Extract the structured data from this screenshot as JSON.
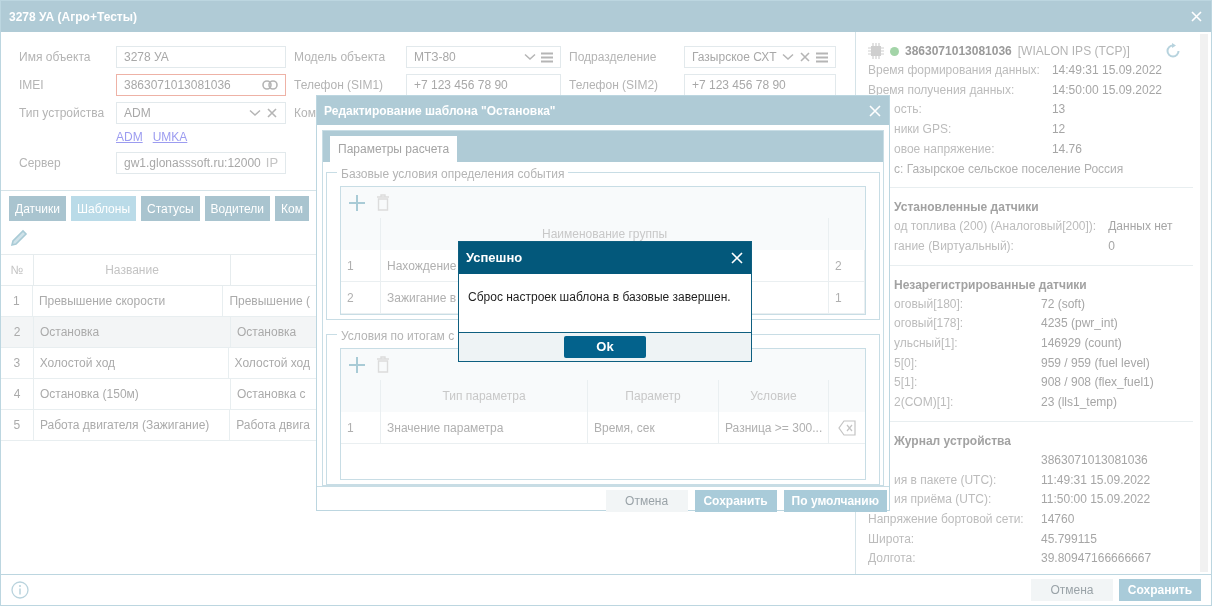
{
  "window": {
    "title": "3278 УА (Агро+Тесты)"
  },
  "form": {
    "rows": [
      {
        "cells": [
          {
            "label": "Имя объекта",
            "value": "3278 УА",
            "kind": "text",
            "invalid": false
          },
          {
            "label": "Модель объекта",
            "value": "МТЗ-80",
            "kind": "select_list",
            "invalid": false
          },
          {
            "label": "Подразделение",
            "value": "Газырское СХТ",
            "kind": "select_clear_list",
            "invalid": false
          }
        ]
      },
      {
        "cells": [
          {
            "label": "IMEI",
            "value": "3863071013081036",
            "kind": "link",
            "invalid": true
          },
          {
            "label": "Телефон (SIM1)",
            "value": "+7 123 456 78 90",
            "kind": "text",
            "invalid": false
          },
          {
            "label": "Телефон (SIM2)",
            "value": "+7 123 456 78 90",
            "kind": "text",
            "invalid": false
          }
        ]
      },
      {
        "cells": [
          {
            "label": "Тип устройства",
            "value": "ADM",
            "kind": "select_clear",
            "invalid": false
          },
          {
            "label": "Ком",
            "kind": "label_only"
          }
        ]
      },
      {
        "links": [
          "ADM",
          "UMKA"
        ]
      },
      {
        "cells": [
          {
            "label": "Сервер",
            "value": "gw1.glonasssoft.ru:12000",
            "kind": "suffix",
            "suffix": "IP",
            "invalid": false
          }
        ]
      }
    ]
  },
  "tabs": [
    {
      "label": "Датчики",
      "selected": false
    },
    {
      "label": "Шаблоны",
      "selected": true
    },
    {
      "label": "Статусы",
      "selected": false
    },
    {
      "label": "Водители",
      "selected": false
    },
    {
      "label": "Ком",
      "selected": false
    }
  ],
  "templates_table": {
    "columns": [
      "№",
      "Название"
    ],
    "rows": [
      {
        "cells": [
          "1",
          "Превышение скорости",
          "Превышение ("
        ],
        "selected": false
      },
      {
        "cells": [
          "2",
          "Остановка",
          "Остановка"
        ],
        "selected": true
      },
      {
        "cells": [
          "3",
          "Холостой ход",
          "Холостой ход"
        ],
        "selected": false
      },
      {
        "cells": [
          "4",
          "Остановка (150м)",
          "Остановка с"
        ],
        "selected": false
      },
      {
        "cells": [
          "5",
          "Работа двигателя (Зажигание)",
          "Работа двига"
        ],
        "selected": false
      }
    ]
  },
  "edit_dialog": {
    "title": "Редактирование шаблона \"Остановка\"",
    "tabs": [
      {
        "label": "Параметры расчета",
        "selected": true
      }
    ],
    "base_conditions": {
      "legend": "Базовые условия определения события",
      "columns": [
        "",
        "Наименование группы"
      ],
      "rows": [
        {
          "cells": [
            "1",
            "Нахождение",
            "2"
          ]
        },
        {
          "cells": [
            "2",
            "Зажигание в",
            "1"
          ]
        }
      ]
    },
    "result_conditions": {
      "legend": "Условия по итогам с",
      "columns": [
        "",
        "Тип параметра",
        "Параметр",
        "Условие"
      ],
      "rows": [
        {
          "cells": [
            "1",
            "Значение параметра",
            "Время, сек",
            "Разница >= 300..."
          ]
        }
      ]
    },
    "buttons": [
      {
        "label": "Отмена",
        "disabled": true
      },
      {
        "label": "Сохранить",
        "disabled": false
      },
      {
        "label": "По умолчанию",
        "disabled": false
      }
    ]
  },
  "success_dialog": {
    "title": "Успешно",
    "message": "Сброс настроек шаблона в базовые завершен.",
    "button": "Ok"
  },
  "device_panel": {
    "id": "3863071013081036",
    "protocol": "[WIALON IPS (TCP)]",
    "online": true,
    "sections": [
      {
        "rows": [
          {
            "label": "Время формирования данных:",
            "value": "14:49:31 15.09.2022"
          },
          {
            "label": "Время получения данных:",
            "value": "14:50:00 15.09.2022"
          },
          {
            "label": "ость:",
            "value": "13"
          },
          {
            "label": "ники GPS:",
            "value": "12"
          },
          {
            "label": "овое напряжение:",
            "value": "14.76"
          },
          {
            "text": "с: Газырское сельское поселение Россия"
          }
        ]
      },
      {
        "title": "Установленные датчики",
        "rows": [
          {
            "label": "од топлива (200) (Аналоговый[200]):",
            "value": "Данных нет"
          },
          {
            "label": "гание (Виртуальный):",
            "value": "0"
          }
        ]
      },
      {
        "title": "Незарегистрированные датчики",
        "rows": [
          {
            "label": "оговый[180]:",
            "value": "72 (soft)"
          },
          {
            "label": "оговый[178]:",
            "value": "4235 (pwr_int)"
          },
          {
            "label": "ульсный[1]:",
            "value": "146929 (count)"
          },
          {
            "label": "5[0]:",
            "value": "959 / 959 (fuel level)"
          },
          {
            "label": "5[1]:",
            "value": "908 / 908 (flex_fuel1)"
          },
          {
            "label": "2(COM)[1]:",
            "value": "23 (lls1_temp)"
          }
        ]
      },
      {
        "title": "Журнал устройства",
        "rows": [
          {
            "value": "3863071013081036"
          },
          {
            "label": "ия в пакете (UTC):",
            "value": "11:49:31 15.09.2022"
          },
          {
            "label": "ия приёма (UTC):",
            "value": "11:50:00 15.09.2022"
          },
          {
            "label": "Напряжение бортовой сети:",
            "value": "14760"
          },
          {
            "label": "Широта:",
            "value": "45.799115"
          },
          {
            "label": "Долгота:",
            "value": "39.80947166666667"
          }
        ]
      }
    ]
  },
  "footer": {
    "buttons": [
      {
        "label": "Отмена",
        "disabled": true
      },
      {
        "label": "Сохранить",
        "disabled": false
      }
    ]
  }
}
